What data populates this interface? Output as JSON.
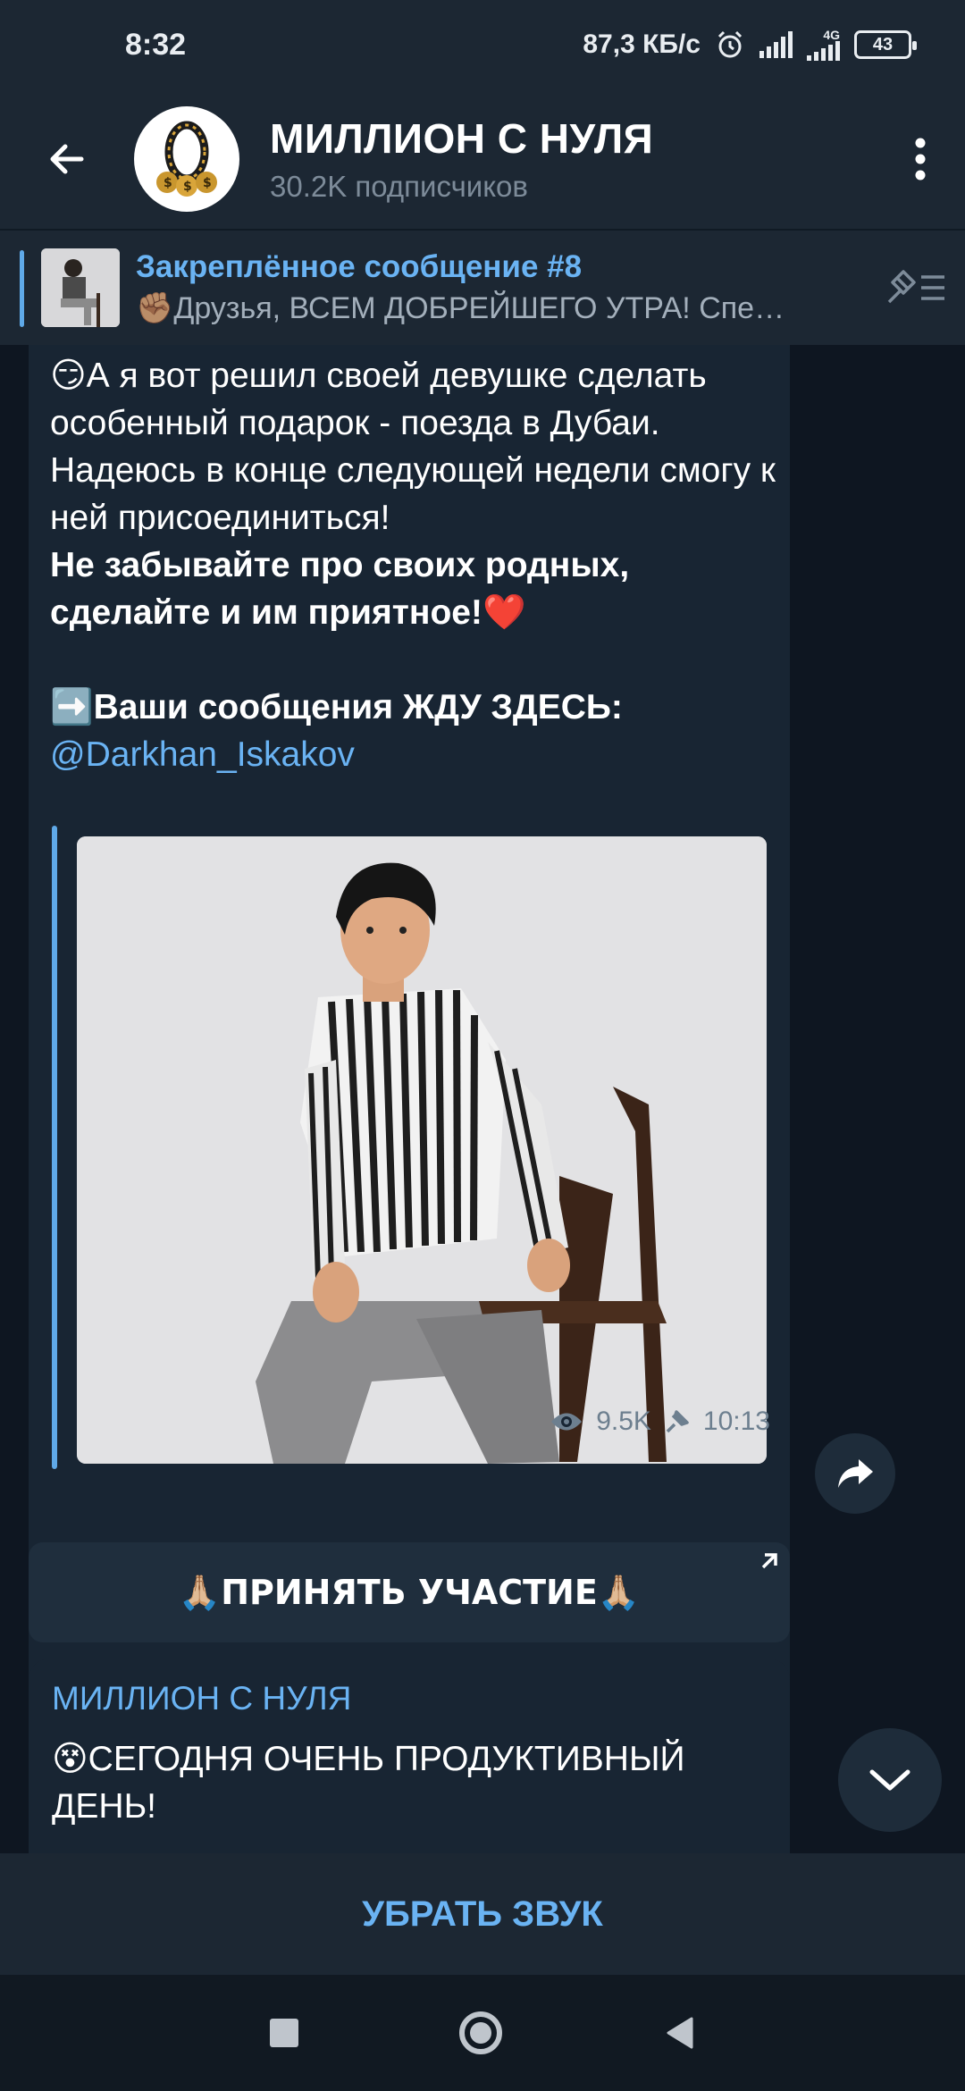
{
  "status_bar": {
    "time": "8:32",
    "network_speed": "87,3 КБ/с",
    "network_type": "4G",
    "battery": "43"
  },
  "header": {
    "title": "МИЛЛИОН С НУЛЯ",
    "subtitle": "30.2K подписчиков",
    "back_icon": "arrow-left-icon",
    "menu_icon": "more-vertical-icon"
  },
  "pinned": {
    "title": "Закреплённое сообщение #8",
    "preview": "✊🏽Друзья, ВСЕМ ДОБРЕЙШЕГО УТРА! Спе…"
  },
  "message": {
    "paragraph1_emoji": "😏",
    "paragraph1": "А я вот решил своей девушке сделать особенный подарок - поезда в Дубаи. Надеюсь в конце следующей недели смогу к ней присоединиться!",
    "paragraph2": "Не забывайте про своих родных, сделайте и им приятное!",
    "paragraph2_emoji": "❤️",
    "cta_emoji": "➡️",
    "cta": "Ваши сообщения ЖДУ ЗДЕСЬ:",
    "mention": "@Darkhan_Iskakov",
    "views": "9.5K",
    "time": "10:13"
  },
  "inline_button": {
    "label": "🙏🏼ПРИНЯТЬ УЧАСТИЕ🙏🏼"
  },
  "next_message": {
    "author": "МИЛЛИОН С НУЛЯ",
    "emoji": "😵",
    "text": "СЕГОДНЯ ОЧЕНЬ ПРОДУКТИВНЫЙ ДЕНЬ!"
  },
  "bottom_bar": {
    "mute_label": "УБРАТЬ ЗВУК"
  },
  "colors": {
    "accent": "#6ab3f3",
    "background": "#0e1621",
    "bubble": "#182533",
    "header": "#1c2733"
  }
}
